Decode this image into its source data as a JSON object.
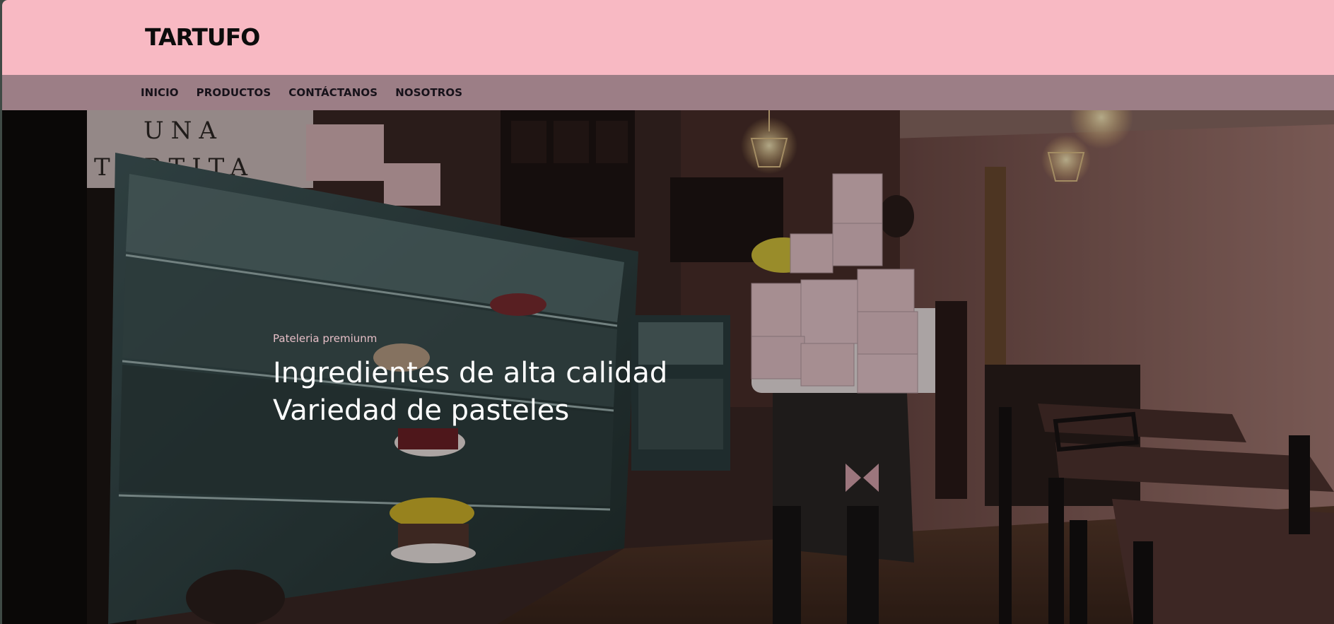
{
  "brand": {
    "name": "TARTUFO"
  },
  "nav": {
    "items": [
      "INICIO",
      "PRODUCTOS",
      "CONTÁCTANOS",
      "NOSOTROS"
    ]
  },
  "hero": {
    "kicker": "Pateleria premiunm",
    "line1": "Ingredientes de alta calidad",
    "line2": "Variedad de pasteles",
    "sign_text": "UNA TORTITA"
  },
  "colors": {
    "topbar": "#f8b9c3",
    "navbar": "#9c7e86",
    "headline": "#ffffff",
    "kicker": "#e6bfc7"
  }
}
